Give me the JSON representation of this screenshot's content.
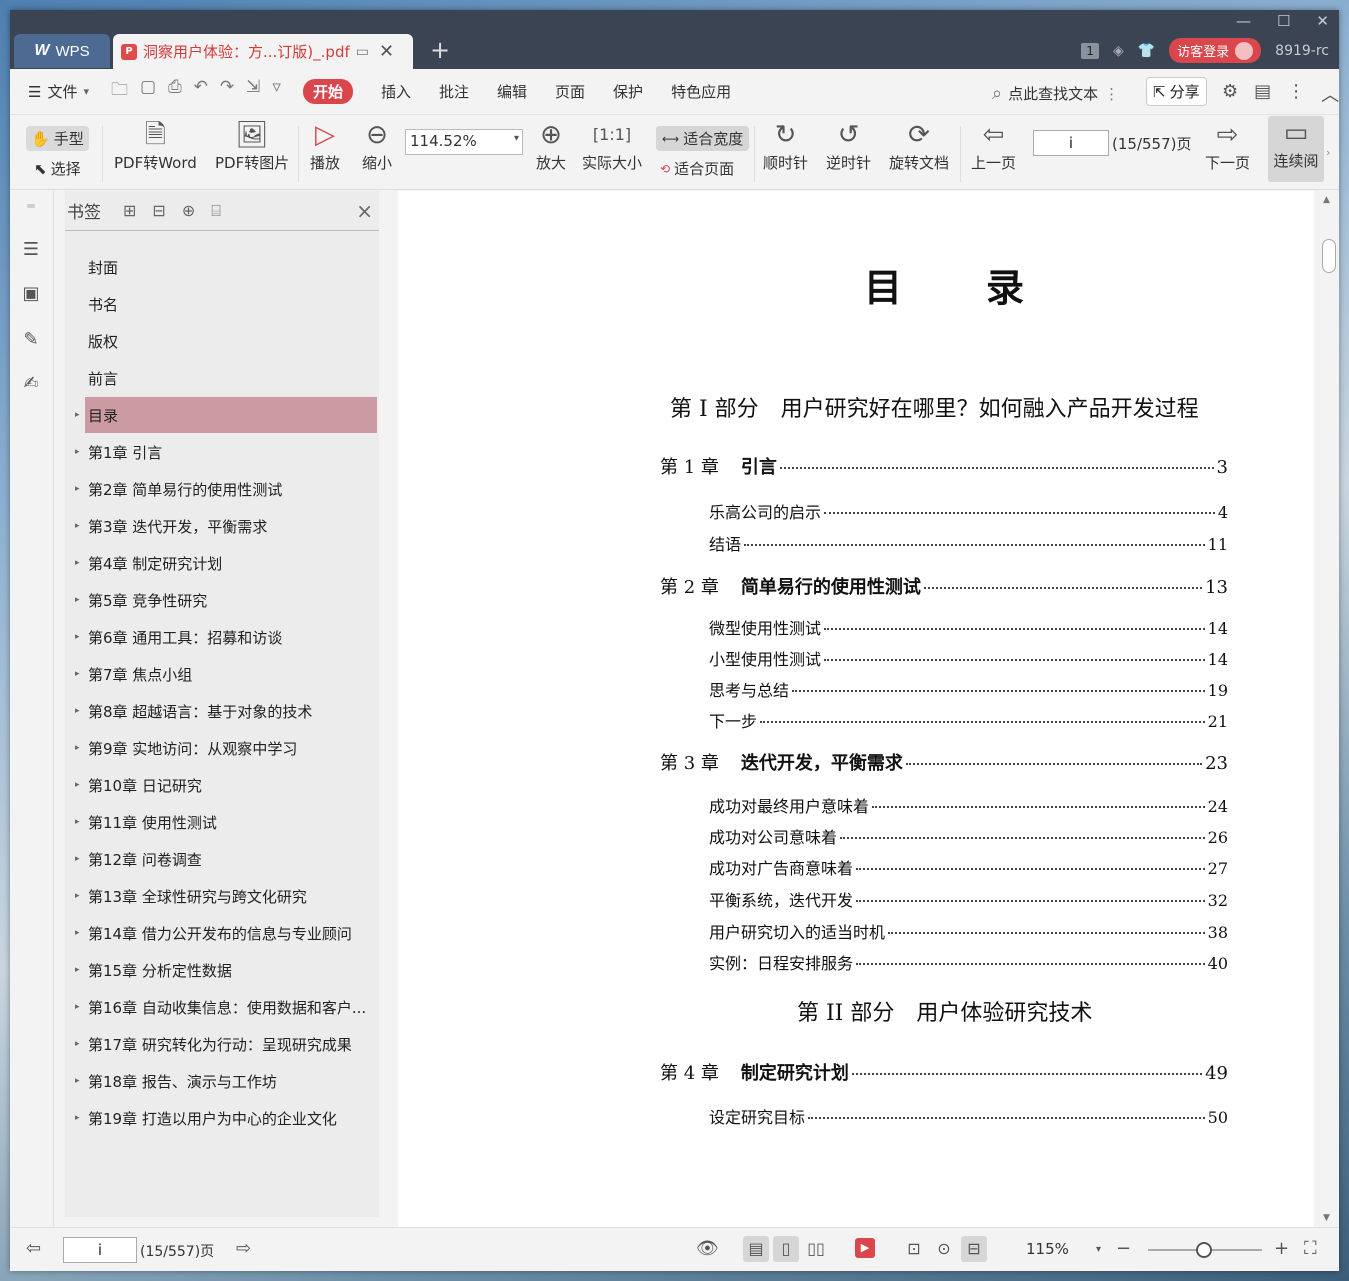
{
  "titlebar": {
    "app_tab": "WPS",
    "doc_tab": "洞察用户体验：方...订版)_.pdf",
    "badge_count": "1",
    "login_label": "访客登录",
    "version_label": "8919-rc"
  },
  "menubar": {
    "file_label": "文件",
    "tabs": [
      "开始",
      "插入",
      "批注",
      "编辑",
      "页面",
      "保护",
      "特色应用"
    ],
    "search_label": "点此查找文本",
    "share_label": "分享"
  },
  "toolbar": {
    "hand_label": "手型",
    "select_label": "选择",
    "pdf_to_word": "PDF转Word",
    "pdf_to_image": "PDF转图片",
    "play_label": "播放",
    "zoom_out_label": "缩小",
    "zoom_value": "114.52%",
    "zoom_in_label": "放大",
    "actual_size_label": "实际大小",
    "fit_width_label": "适合宽度",
    "fit_page_label": "适合页面",
    "clockwise_label": "顺时针",
    "counterclockwise_label": "逆时针",
    "rotate_doc_label": "旋转文档",
    "prev_page_label": "上一页",
    "page_input": "i",
    "page_count": "(15/557)页",
    "next_page_label": "下一页",
    "continuous_label": "连续阅"
  },
  "bookmarks": {
    "title": "书签",
    "items": [
      {
        "label": "封面"
      },
      {
        "label": "书名"
      },
      {
        "label": "版权"
      },
      {
        "label": "前言"
      },
      {
        "label": "目录"
      },
      {
        "label": "第1章  引言"
      },
      {
        "label": "第2章  简单易行的使用性测试"
      },
      {
        "label": "第3章  迭代开发，平衡需求"
      },
      {
        "label": "第4章  制定研究计划"
      },
      {
        "label": "第5章  竞争性研究"
      },
      {
        "label": "第6章  通用工具：招募和访谈"
      },
      {
        "label": "第7章  焦点小组"
      },
      {
        "label": "第8章  超越语言：基于对象的技术"
      },
      {
        "label": "第9章  实地访问：从观察中学习"
      },
      {
        "label": "第10章  日记研究"
      },
      {
        "label": "第11章  使用性测试"
      },
      {
        "label": "第12章  问卷调查"
      },
      {
        "label": "第13章  全球性研究与跨文化研究"
      },
      {
        "label": "第14章  借力公开发布的信息与专业顾问"
      },
      {
        "label": "第15章  分析定性数据"
      },
      {
        "label": "第16章  自动收集信息：使用数据和客户..."
      },
      {
        "label": "第17章  研究转化为行动：呈现研究成果"
      },
      {
        "label": "第18章  报告、演示与工作坊"
      },
      {
        "label": "第19章  打造以用户为中心的企业文化"
      }
    ]
  },
  "toc": {
    "title": "目录",
    "part1": "第 I 部分　用户研究好在哪里？如何融入产品开发过程",
    "part2": "第 II 部分　用户体验研究技术",
    "chapters": [
      {
        "label": "第 1 章",
        "title": "引言",
        "page": "3"
      },
      {
        "label": "第 2 章",
        "title": "简单易行的使用性测试",
        "page": "13"
      },
      {
        "label": "第 3 章",
        "title": "迭代开发，平衡需求",
        "page": "23"
      },
      {
        "label": "第 4 章",
        "title": "制定研究计划",
        "page": "49"
      }
    ],
    "sections": [
      {
        "title": "乐高公司的启示",
        "page": "4"
      },
      {
        "title": "结语",
        "page": "11"
      },
      {
        "title": "微型使用性测试",
        "page": "14"
      },
      {
        "title": "小型使用性测试",
        "page": "14"
      },
      {
        "title": "思考与总结",
        "page": "19"
      },
      {
        "title": "下一步",
        "page": "21"
      },
      {
        "title": "成功对最终用户意味着",
        "page": "24"
      },
      {
        "title": "成功对公司意味着",
        "page": "26"
      },
      {
        "title": "成功对广告商意味着",
        "page": "27"
      },
      {
        "title": "平衡系统，迭代开发",
        "page": "32"
      },
      {
        "title": "用户研究切入的适当时机",
        "page": "38"
      },
      {
        "title": "实例：日程安排服务",
        "page": "40"
      },
      {
        "title": "设定研究目标",
        "page": "50"
      }
    ]
  },
  "statusbar": {
    "page_input": "i",
    "page_count": "(15/557)页",
    "zoom_percent": "115%"
  }
}
